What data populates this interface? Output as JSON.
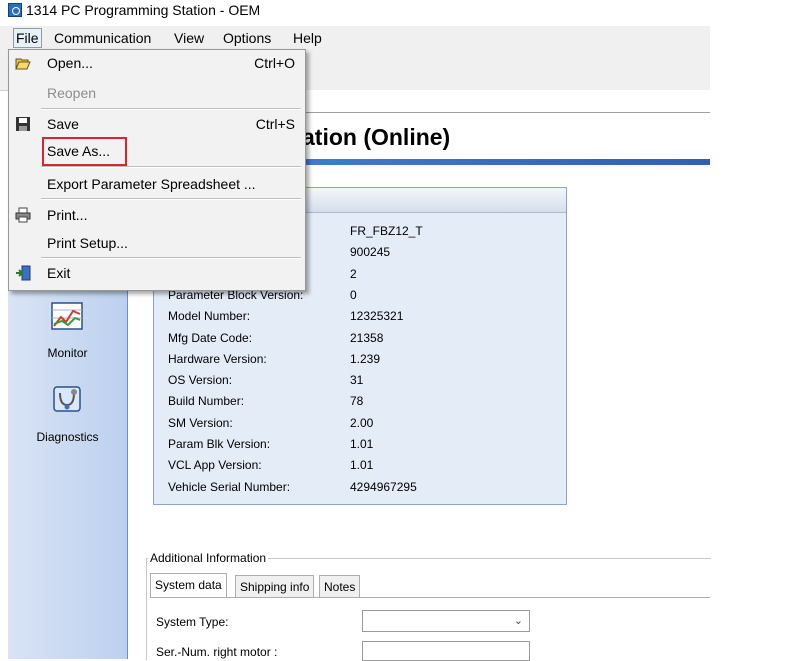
{
  "window": {
    "title": "1314 PC Programming Station - OEM"
  },
  "menubar": {
    "file": "File",
    "communication": "Communication",
    "view": "View",
    "options": "Options",
    "help": "Help"
  },
  "file_menu": {
    "open": "Open...",
    "open_shortcut": "Ctrl+O",
    "reopen": "Reopen",
    "save": "Save",
    "save_shortcut": "Ctrl+S",
    "save_as": "Save As...",
    "export": "Export Parameter Spreadsheet ...",
    "print": "Print...",
    "print_setup": "Print Setup...",
    "exit": "Exit"
  },
  "main": {
    "heading": "ation (Online)"
  },
  "sidebar": {
    "items": [
      {
        "label": "Monitor"
      },
      {
        "label": "Diagnostics"
      }
    ]
  },
  "info": {
    "rows": [
      {
        "label": "",
        "value": "FR_FBZ12_T"
      },
      {
        "label": "",
        "value": "900245"
      },
      {
        "label": "",
        "value": "2"
      },
      {
        "label": "Parameter Block Version:",
        "value": "0"
      },
      {
        "label": "Model Number:",
        "value": "12325321"
      },
      {
        "label": "Mfg Date Code:",
        "value": "21358"
      },
      {
        "label": "Hardware Version:",
        "value": "1.239"
      },
      {
        "label": "OS Version:",
        "value": "31"
      },
      {
        "label": "Build Number:",
        "value": "78"
      },
      {
        "label": "SM Version:",
        "value": "2.00"
      },
      {
        "label": "Param Blk Version:",
        "value": "1.01"
      },
      {
        "label": "VCL App Version:",
        "value": "1.01"
      },
      {
        "label": "Vehicle Serial Number:",
        "value": "4294967295"
      }
    ]
  },
  "additional": {
    "title": "Additional Information",
    "tabs": [
      "System data",
      "Shipping info",
      "Notes"
    ],
    "system_type_label": "System Type:",
    "system_type_value": "",
    "sernum_label": "Ser.-Num. right motor :",
    "sernum_value": ""
  },
  "colors": {
    "accent": "#2f5fb0",
    "highlight_box": "#d9262c",
    "panel_bg": "#e4ecf8"
  }
}
